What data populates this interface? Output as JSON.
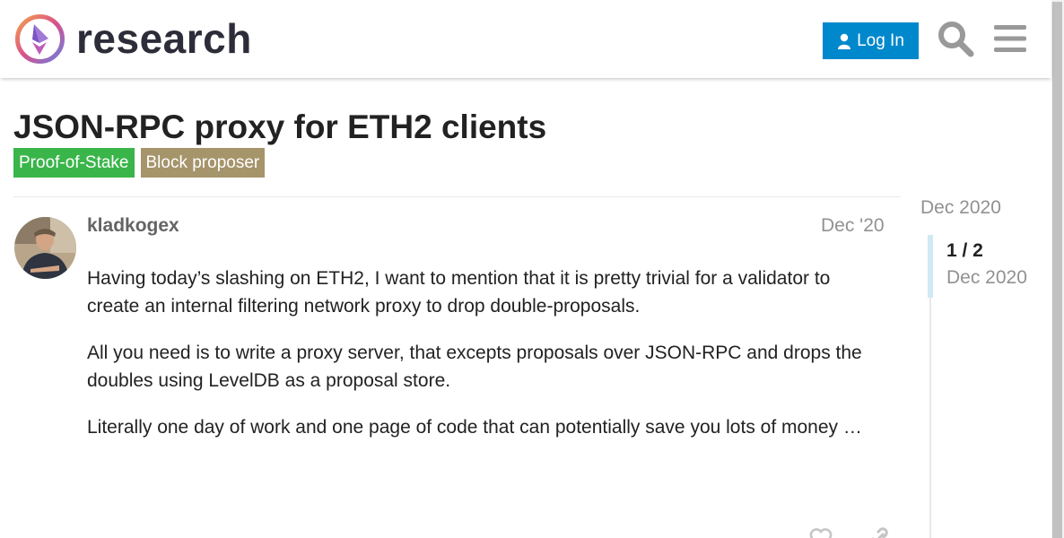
{
  "header": {
    "logo_text": "research",
    "login_label": "Log In"
  },
  "topic": {
    "title": "JSON-RPC proxy for ETH2 clients",
    "tags": [
      {
        "label": "Proof-of-Stake",
        "color": "#3ab54a"
      },
      {
        "label": "Block proposer",
        "color": "#a6946b"
      }
    ]
  },
  "post": {
    "username": "kladkogex",
    "date": "Dec '20",
    "paragraphs": [
      "Having today’s slashing on ETH2, I want to mention that it is pretty trivial for a validator to create an internal filtering network proxy to drop double-proposals.",
      "All you need is to write a proxy server, that excepts proposals over JSON-RPC and drops the doubles using LevelDB as a proposal store.",
      "Literally one day of work and one page of code that can potentially save you lots of money …"
    ]
  },
  "timeline": {
    "start_date": "Dec 2020",
    "position": "1 / 2",
    "current_date": "Dec 2020"
  },
  "colors": {
    "accent": "#0088cc",
    "tag_pos": "#3ab54a",
    "tag_bp": "#a6946b"
  }
}
